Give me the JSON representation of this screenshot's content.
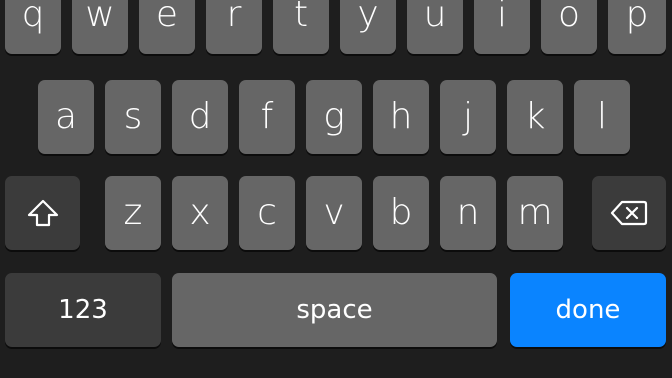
{
  "keyboard": {
    "row1": [
      "q",
      "w",
      "e",
      "r",
      "t",
      "y",
      "u",
      "i",
      "o",
      "p"
    ],
    "row2": [
      "a",
      "s",
      "d",
      "f",
      "g",
      "h",
      "j",
      "k",
      "l"
    ],
    "row3": [
      "z",
      "x",
      "c",
      "v",
      "b",
      "n",
      "m"
    ],
    "shift_icon": "shift-icon",
    "delete_icon": "backspace-icon",
    "numbers_label": "123",
    "space_label": "space",
    "done_label": "done"
  },
  "colors": {
    "background": "#1e1e1e",
    "letter_key": "#666666",
    "function_key": "#3b3b3b",
    "done_key": "#0a84ff",
    "text": "#ffffff"
  }
}
